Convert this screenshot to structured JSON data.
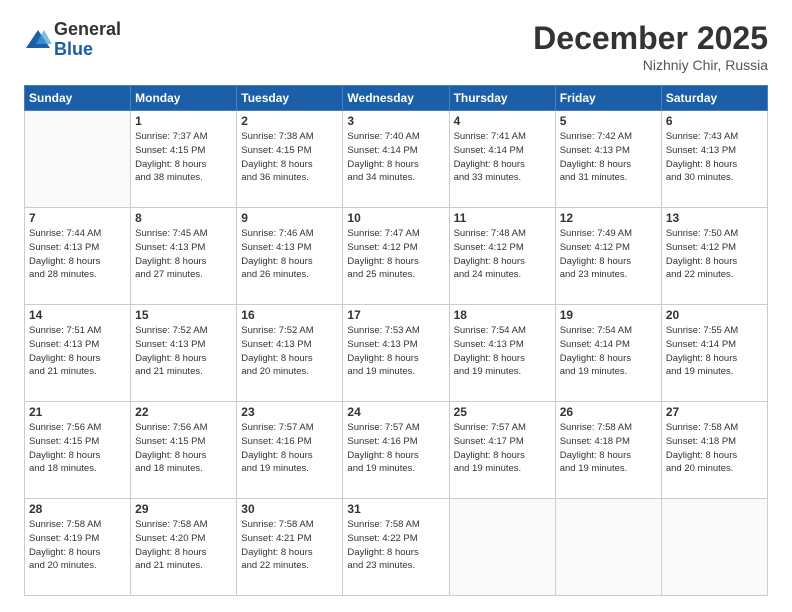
{
  "header": {
    "logo_general": "General",
    "logo_blue": "Blue",
    "month_title": "December 2025",
    "location": "Nizhniy Chir, Russia"
  },
  "days_of_week": [
    "Sunday",
    "Monday",
    "Tuesday",
    "Wednesday",
    "Thursday",
    "Friday",
    "Saturday"
  ],
  "weeks": [
    [
      {
        "day": "",
        "info": ""
      },
      {
        "day": "1",
        "info": "Sunrise: 7:37 AM\nSunset: 4:15 PM\nDaylight: 8 hours\nand 38 minutes."
      },
      {
        "day": "2",
        "info": "Sunrise: 7:38 AM\nSunset: 4:15 PM\nDaylight: 8 hours\nand 36 minutes."
      },
      {
        "day": "3",
        "info": "Sunrise: 7:40 AM\nSunset: 4:14 PM\nDaylight: 8 hours\nand 34 minutes."
      },
      {
        "day": "4",
        "info": "Sunrise: 7:41 AM\nSunset: 4:14 PM\nDaylight: 8 hours\nand 33 minutes."
      },
      {
        "day": "5",
        "info": "Sunrise: 7:42 AM\nSunset: 4:13 PM\nDaylight: 8 hours\nand 31 minutes."
      },
      {
        "day": "6",
        "info": "Sunrise: 7:43 AM\nSunset: 4:13 PM\nDaylight: 8 hours\nand 30 minutes."
      }
    ],
    [
      {
        "day": "7",
        "info": "Sunrise: 7:44 AM\nSunset: 4:13 PM\nDaylight: 8 hours\nand 28 minutes."
      },
      {
        "day": "8",
        "info": "Sunrise: 7:45 AM\nSunset: 4:13 PM\nDaylight: 8 hours\nand 27 minutes."
      },
      {
        "day": "9",
        "info": "Sunrise: 7:46 AM\nSunset: 4:13 PM\nDaylight: 8 hours\nand 26 minutes."
      },
      {
        "day": "10",
        "info": "Sunrise: 7:47 AM\nSunset: 4:12 PM\nDaylight: 8 hours\nand 25 minutes."
      },
      {
        "day": "11",
        "info": "Sunrise: 7:48 AM\nSunset: 4:12 PM\nDaylight: 8 hours\nand 24 minutes."
      },
      {
        "day": "12",
        "info": "Sunrise: 7:49 AM\nSunset: 4:12 PM\nDaylight: 8 hours\nand 23 minutes."
      },
      {
        "day": "13",
        "info": "Sunrise: 7:50 AM\nSunset: 4:12 PM\nDaylight: 8 hours\nand 22 minutes."
      }
    ],
    [
      {
        "day": "14",
        "info": "Sunrise: 7:51 AM\nSunset: 4:13 PM\nDaylight: 8 hours\nand 21 minutes."
      },
      {
        "day": "15",
        "info": "Sunrise: 7:52 AM\nSunset: 4:13 PM\nDaylight: 8 hours\nand 21 minutes."
      },
      {
        "day": "16",
        "info": "Sunrise: 7:52 AM\nSunset: 4:13 PM\nDaylight: 8 hours\nand 20 minutes."
      },
      {
        "day": "17",
        "info": "Sunrise: 7:53 AM\nSunset: 4:13 PM\nDaylight: 8 hours\nand 19 minutes."
      },
      {
        "day": "18",
        "info": "Sunrise: 7:54 AM\nSunset: 4:13 PM\nDaylight: 8 hours\nand 19 minutes."
      },
      {
        "day": "19",
        "info": "Sunrise: 7:54 AM\nSunset: 4:14 PM\nDaylight: 8 hours\nand 19 minutes."
      },
      {
        "day": "20",
        "info": "Sunrise: 7:55 AM\nSunset: 4:14 PM\nDaylight: 8 hours\nand 19 minutes."
      }
    ],
    [
      {
        "day": "21",
        "info": "Sunrise: 7:56 AM\nSunset: 4:15 PM\nDaylight: 8 hours\nand 18 minutes."
      },
      {
        "day": "22",
        "info": "Sunrise: 7:56 AM\nSunset: 4:15 PM\nDaylight: 8 hours\nand 18 minutes."
      },
      {
        "day": "23",
        "info": "Sunrise: 7:57 AM\nSunset: 4:16 PM\nDaylight: 8 hours\nand 19 minutes."
      },
      {
        "day": "24",
        "info": "Sunrise: 7:57 AM\nSunset: 4:16 PM\nDaylight: 8 hours\nand 19 minutes."
      },
      {
        "day": "25",
        "info": "Sunrise: 7:57 AM\nSunset: 4:17 PM\nDaylight: 8 hours\nand 19 minutes."
      },
      {
        "day": "26",
        "info": "Sunrise: 7:58 AM\nSunset: 4:18 PM\nDaylight: 8 hours\nand 19 minutes."
      },
      {
        "day": "27",
        "info": "Sunrise: 7:58 AM\nSunset: 4:18 PM\nDaylight: 8 hours\nand 20 minutes."
      }
    ],
    [
      {
        "day": "28",
        "info": "Sunrise: 7:58 AM\nSunset: 4:19 PM\nDaylight: 8 hours\nand 20 minutes."
      },
      {
        "day": "29",
        "info": "Sunrise: 7:58 AM\nSunset: 4:20 PM\nDaylight: 8 hours\nand 21 minutes."
      },
      {
        "day": "30",
        "info": "Sunrise: 7:58 AM\nSunset: 4:21 PM\nDaylight: 8 hours\nand 22 minutes."
      },
      {
        "day": "31",
        "info": "Sunrise: 7:58 AM\nSunset: 4:22 PM\nDaylight: 8 hours\nand 23 minutes."
      },
      {
        "day": "",
        "info": ""
      },
      {
        "day": "",
        "info": ""
      },
      {
        "day": "",
        "info": ""
      }
    ]
  ]
}
